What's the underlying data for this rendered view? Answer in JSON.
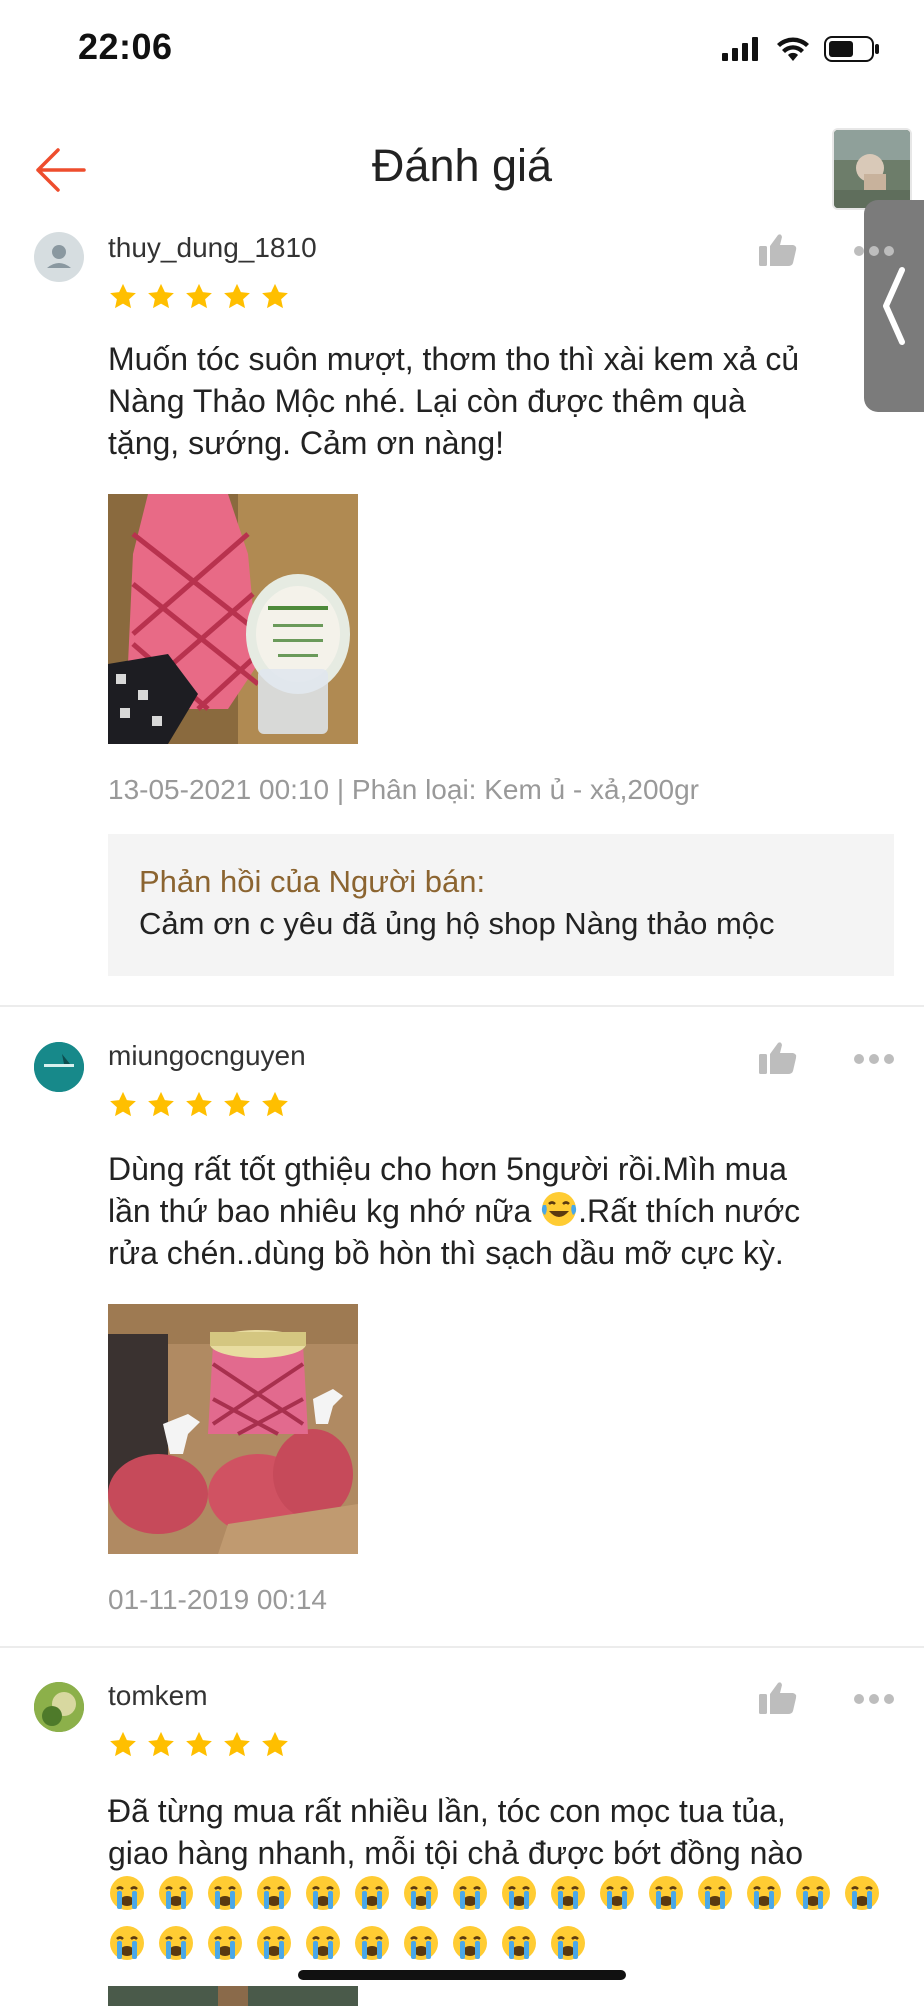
{
  "status_bar": {
    "time": "22:06"
  },
  "header": {
    "title": "Đánh giá"
  },
  "reviews": [
    {
      "username": "thuy_dung_1810",
      "rating": 5,
      "text": "Muốn tóc suôn mượt, thơm tho thì xài kem xả củ\nNàng Thảo Mộc nhé. Lại còn được thêm quà\ntặng, sướng. Cảm ơn nàng!",
      "meta": "13-05-2021 00:10 | Phân loại: Kem ủ - xả,200gr",
      "seller_reply_label": "Phản hồi của Người bán:",
      "seller_reply_text": "Cảm ơn c yêu đã ủng hộ shop Nàng thảo mộc"
    },
    {
      "username": "miungocnguyen",
      "rating": 5,
      "text_line1": "Dùng rất tốt gthiệu cho hơn 5người rồi.Mìh mua",
      "text_line2a": "lần thứ bao nhiêu kg nhớ nữa ",
      "text_line2b": ".Rất thích nước",
      "text_line3": "rửa chén..dùng bồ hòn thì sạch dầu mỡ cực kỳ.",
      "emoji": "laughing-tears",
      "meta": "01-11-2019 00:14"
    },
    {
      "username": "tomkem",
      "rating": 5,
      "text": "Đã từng mua rất nhiều lần, tóc con mọc tua tủa,\ngiao hàng nhanh, mỗi tội chả được bớt đồng nào",
      "emoji": "crying-face",
      "emoji_count": 26
    }
  ],
  "colors": {
    "accent": "#ee4d2d",
    "star": "#ffbf00",
    "seller_label": "#8b6430",
    "meta_text": "#999999"
  }
}
